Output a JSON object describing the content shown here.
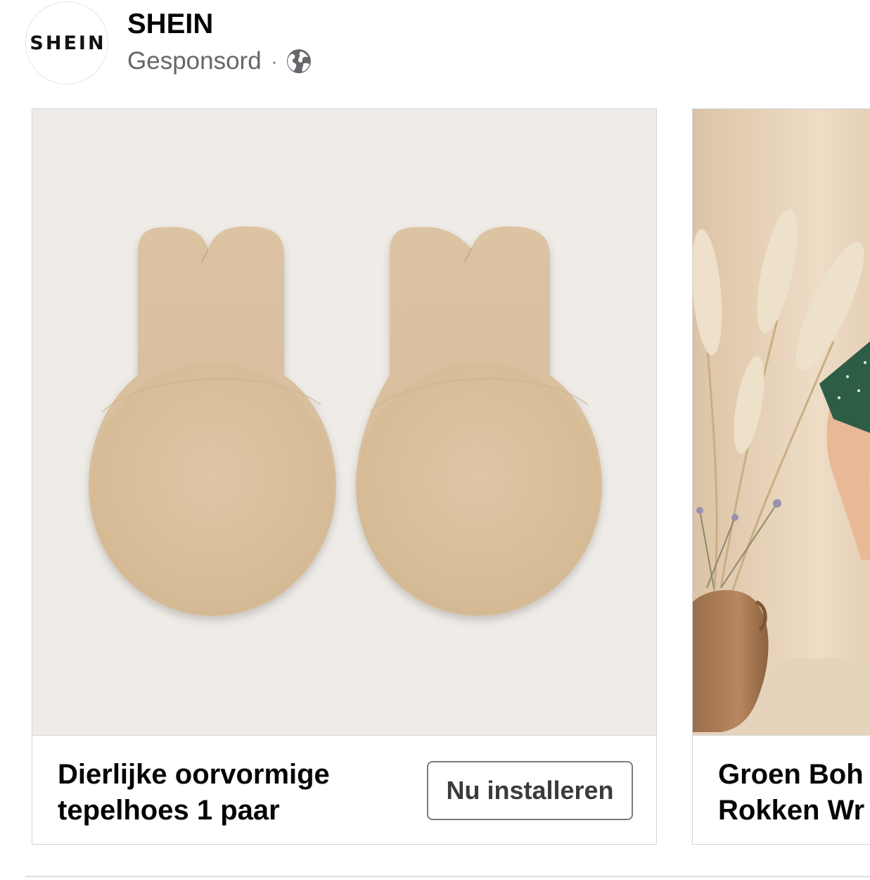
{
  "post": {
    "page_name": "SHEIN",
    "avatar_text": "SHEIN",
    "sponsored_label": "Gesponsord",
    "separator": "·",
    "audience_icon": "globe-icon"
  },
  "carousel": {
    "cards": [
      {
        "title": "Dierlijke oorvormige\ntepelhoes 1 paar",
        "cta_label": "Nu installeren",
        "image": "nude-bunny-ear-nipple-covers-product-photo"
      },
      {
        "title": "Groen Boh\nRokken Wr",
        "image": "model-with-pampas-grass-and-clay-vase-photo"
      }
    ]
  },
  "colors": {
    "secondary_text": "#65676b",
    "card_border": "#d3d5d9",
    "button_border": "#7a7c80",
    "product_background": "#efebe7",
    "product_color": "#dcc3a2"
  }
}
